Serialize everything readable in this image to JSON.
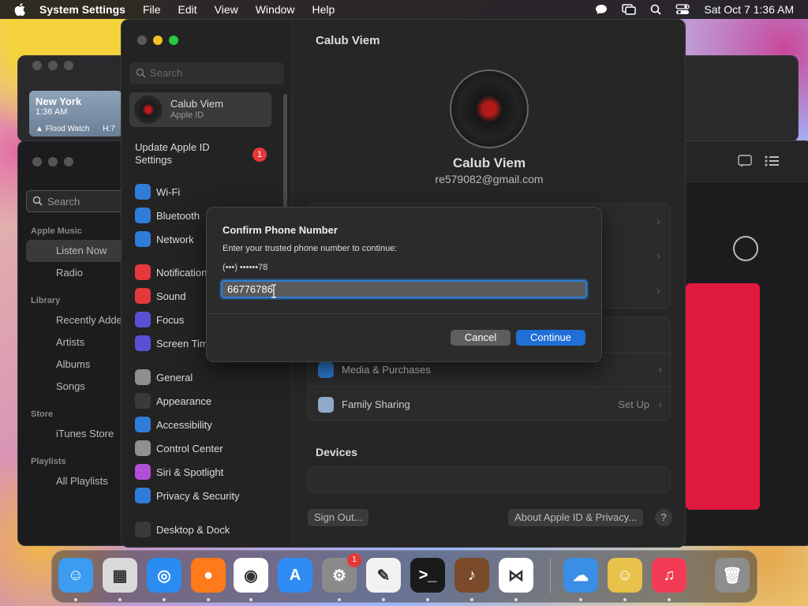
{
  "menubar": {
    "app_name": "System Settings",
    "menus": [
      "File",
      "Edit",
      "View",
      "Window",
      "Help"
    ],
    "datetime": "Sat Oct 7  1:36 AM"
  },
  "weather": {
    "city": "New York",
    "time": "1:36 AM",
    "alert": "Flood Watch",
    "extra": "H:7"
  },
  "music": {
    "search_placeholder": "Search",
    "sections": {
      "apple_music": "Apple Music",
      "library": "Library",
      "store": "Store",
      "playlists": "Playlists"
    },
    "items": {
      "listen_now": "Listen Now",
      "radio": "Radio",
      "recently_added": "Recently Adde",
      "artists": "Artists",
      "albums": "Albums",
      "songs": "Songs",
      "itunes_store": "iTunes Store",
      "all_playlists": "All Playlists"
    }
  },
  "settings": {
    "search_placeholder": "Search",
    "account": {
      "name": "Calub Viem",
      "sub": "Apple ID"
    },
    "update": {
      "label": "Update Apple ID Settings",
      "badge": "1"
    },
    "sidebar": [
      {
        "label": "Wi-Fi",
        "color": "#2f7dd8",
        "icon": "wifi-icon"
      },
      {
        "label": "Bluetooth",
        "color": "#2f7dd8",
        "icon": "bluetooth-icon"
      },
      {
        "label": "Network",
        "color": "#2f7dd8",
        "icon": "globe-icon"
      },
      {
        "label": "Notifications",
        "color": "#e5383b",
        "icon": "bell-icon"
      },
      {
        "label": "Sound",
        "color": "#e5383b",
        "icon": "speaker-icon"
      },
      {
        "label": "Focus",
        "color": "#5b4fd6",
        "icon": "moon-icon"
      },
      {
        "label": "Screen Time",
        "color": "#5b4fd6",
        "icon": "hourglass-icon"
      },
      {
        "label": "General",
        "color": "#8e8e93",
        "icon": "gear-icon"
      },
      {
        "label": "Appearance",
        "color": "#3a3a3c",
        "icon": "appearance-icon"
      },
      {
        "label": "Accessibility",
        "color": "#2f7dd8",
        "icon": "accessibility-icon"
      },
      {
        "label": "Control Center",
        "color": "#8e8e93",
        "icon": "control-center-icon"
      },
      {
        "label": "Siri & Spotlight",
        "color": "#b14fd6",
        "icon": "siri-icon"
      },
      {
        "label": "Privacy & Security",
        "color": "#2f7dd8",
        "icon": "hand-icon"
      },
      {
        "label": "Desktop & Dock",
        "color": "#3a3a3c",
        "icon": "dock-icon"
      }
    ],
    "main": {
      "title": "Calub Viem",
      "name": "Calub Viem",
      "email": "re579082@gmail.com",
      "rows": {
        "media": "Media & Purchases",
        "family": "Family Sharing",
        "family_value": "Set Up"
      },
      "devices": "Devices",
      "sign_out": "Sign Out...",
      "about": "About Apple ID & Privacy...",
      "help": "?"
    }
  },
  "dialog": {
    "title": "Confirm Phone Number",
    "message": "Enter your trusted phone number to continue:",
    "masked_phone": "(•••) ••••••78",
    "input_value": "66776786",
    "cancel": "Cancel",
    "continue": "Continue"
  },
  "dock": {
    "apps": [
      {
        "name": "Finder",
        "color": "#3d9bf0",
        "glyph": "☺"
      },
      {
        "name": "Launchpad",
        "color": "#d9d9d9",
        "glyph": "▦"
      },
      {
        "name": "Safari",
        "color": "#2a8cf0",
        "glyph": "◎"
      },
      {
        "name": "Firefox",
        "color": "#ff7a1a",
        "glyph": "●"
      },
      {
        "name": "Chrome",
        "color": "#ffffff",
        "glyph": "◉"
      },
      {
        "name": "App Store",
        "color": "#2f8cf5",
        "glyph": "A"
      },
      {
        "name": "System Settings",
        "color": "#8a8a8a",
        "glyph": "⚙"
      },
      {
        "name": "TextEdit",
        "color": "#f2f2f2",
        "glyph": "✎"
      },
      {
        "name": "Terminal",
        "color": "#1a1a1a",
        "glyph": ">_"
      },
      {
        "name": "GarageBand",
        "color": "#7a4a2a",
        "glyph": "♪"
      },
      {
        "name": "VS Code",
        "color": "#ffffff",
        "glyph": "⋈"
      },
      {
        "name": "Weather",
        "color": "#3a8ee6",
        "glyph": "☁"
      },
      {
        "name": "Ventrilo",
        "color": "#e8c24a",
        "glyph": "☺"
      },
      {
        "name": "Music",
        "color": "#f43b55",
        "glyph": "♫"
      },
      {
        "name": "Trash",
        "color": "#8d8d8d",
        "glyph": "🗑"
      }
    ],
    "settings_badge": "1"
  }
}
